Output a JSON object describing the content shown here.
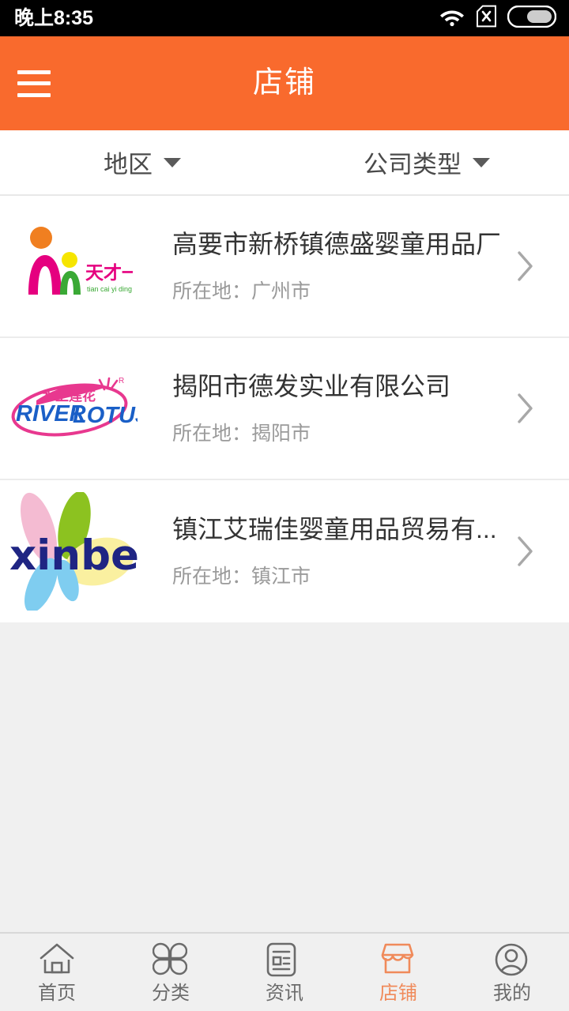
{
  "status_bar": {
    "time": "晚上8:35",
    "icons": [
      "wifi-icon",
      "sim-no-service-icon",
      "battery-icon"
    ],
    "battery_level_percent": 60
  },
  "header": {
    "menu_icon": "hamburger-menu-icon",
    "title": "店铺",
    "background_color": "#f96a2d"
  },
  "filter_bar": {
    "filters": [
      {
        "label": "地区",
        "icon": "chevron-down-icon"
      },
      {
        "label": "公司类型",
        "icon": "chevron-down-icon"
      }
    ]
  },
  "list": {
    "location_prefix": "所在地：",
    "items": [
      {
        "title": "高要市新桥镇德盛婴童用品厂",
        "location": "所在地：广州市",
        "logo_name": "tiancaiyiding-logo",
        "logo_text_cn": "天才一叮",
        "logo_text_pinyin": "tian cai yi ding",
        "logo_colors": [
          "#e5007f",
          "#f07f20",
          "#f6e500",
          "#3aa935"
        ],
        "chevron": "chevron-right-icon"
      },
      {
        "title": "揭阳市德发实业有限公司",
        "location": "所在地：揭阳市",
        "logo_name": "river-lotus-logo",
        "logo_text_en": "RIVER LOTUS",
        "logo_text_cn": "水上莲花",
        "logo_mark": "R",
        "logo_colors": [
          "#1a5fc7",
          "#e8388f"
        ],
        "chevron": "chevron-right-icon"
      },
      {
        "title": "镇江艾瑞佳婴童用品贸易有...",
        "location": "所在地：镇江市",
        "logo_name": "xinbei-logo",
        "logo_text_en": "xinbei",
        "logo_colors": [
          "#1f2583",
          "#f4bbd2",
          "#8cc220",
          "#faf0a0",
          "#7fcdf0"
        ],
        "chevron": "chevron-right-icon"
      }
    ]
  },
  "tab_bar": {
    "active_color": "#f08a5a",
    "inactive_color": "#6b6b6b",
    "tabs": [
      {
        "label": "首页",
        "icon": "home-icon",
        "active": false
      },
      {
        "label": "分类",
        "icon": "clover-categories-icon",
        "active": false
      },
      {
        "label": "资讯",
        "icon": "news-document-icon",
        "active": false
      },
      {
        "label": "店铺",
        "icon": "shop-storefront-icon",
        "active": true
      },
      {
        "label": "我的",
        "icon": "user-profile-icon",
        "active": false
      }
    ]
  }
}
